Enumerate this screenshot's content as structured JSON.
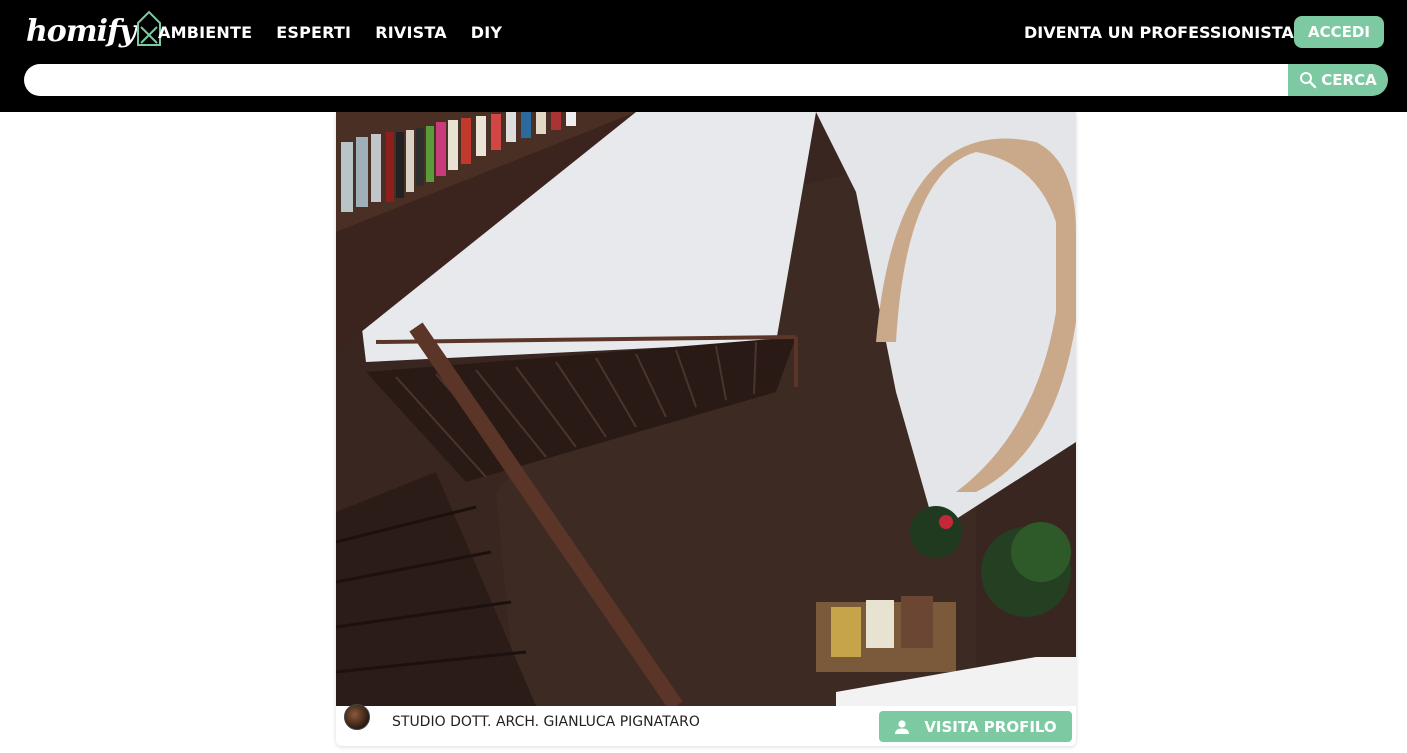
{
  "header": {
    "logo_text": "homify",
    "nav": [
      {
        "label": "AMBIENTE"
      },
      {
        "label": "ESPERTI"
      },
      {
        "label": "RIVISTA"
      },
      {
        "label": "DIY"
      }
    ],
    "pro_link": "DIVENTA UN PROFESSIONISTA",
    "login_label": "ACCEDI"
  },
  "search": {
    "value": "",
    "placeholder": "",
    "button_label": "CERCA",
    "icon": "search-icon"
  },
  "card": {
    "image_icon": "staircase-photo",
    "studio_name": "STUDIO DOTT. ARCH. GIANLUCA PIGNATARO",
    "profile_button": "VISITA PROFILO",
    "profile_icon": "person-icon"
  },
  "colors": {
    "header_bg": "#000000",
    "accent": "#7dc9a2",
    "text": "#222222"
  }
}
